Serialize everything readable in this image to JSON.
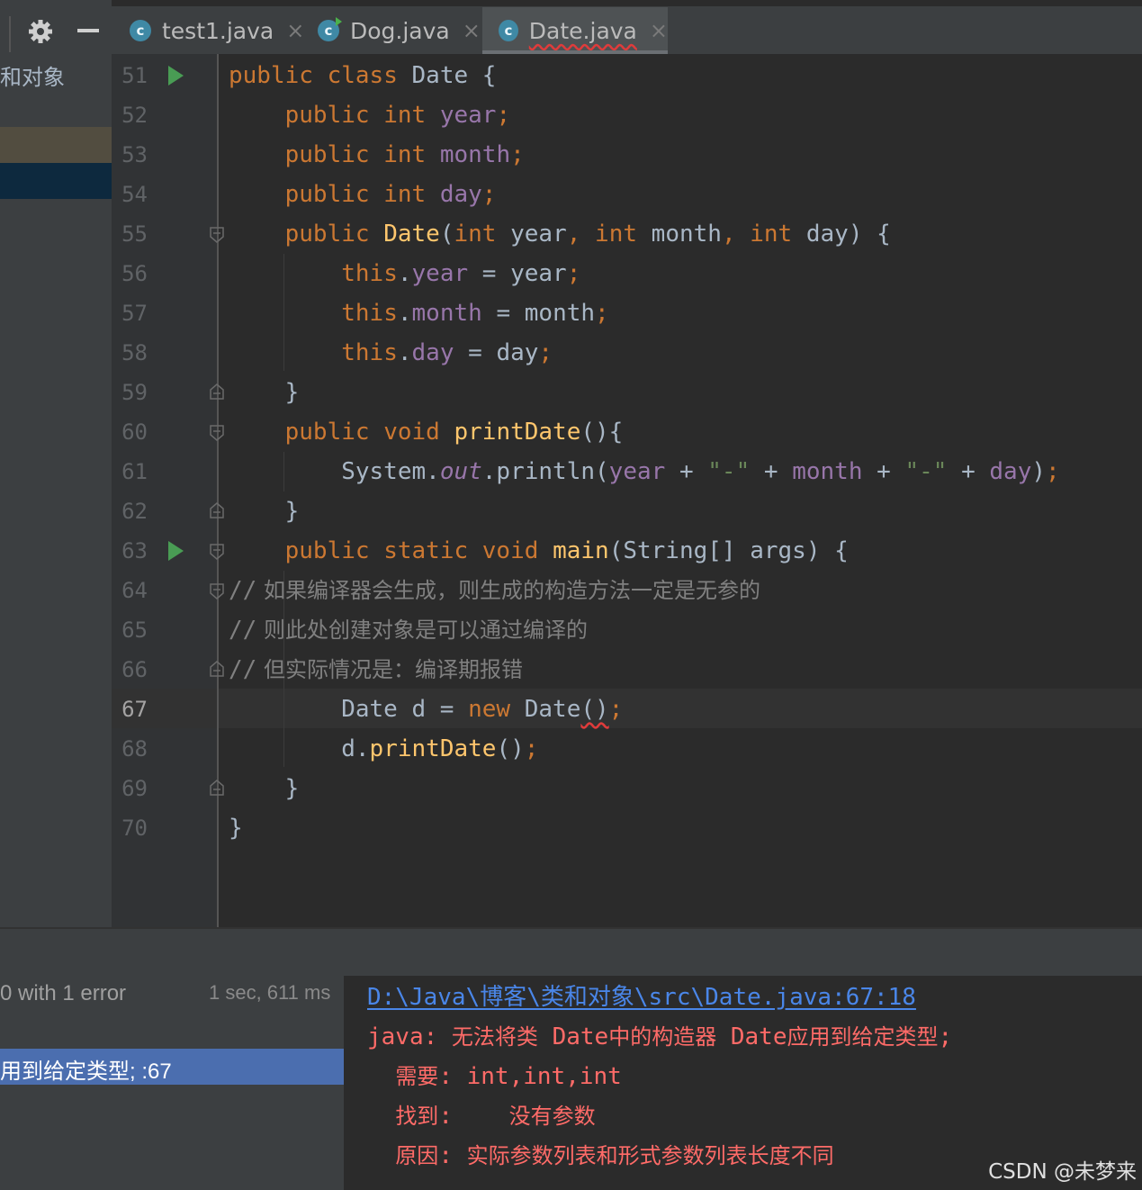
{
  "project_panel": {
    "label": "和对象",
    "settings_icon": "gear-icon",
    "hide_icon": "minus-icon"
  },
  "tabs": [
    {
      "name": "test1.java",
      "icon": "java-class-icon",
      "active": false
    },
    {
      "name": "Dog.java",
      "icon": "java-class-runnable-icon",
      "active": false
    },
    {
      "name": "Date.java",
      "icon": "java-class-icon",
      "active": true
    }
  ],
  "tab_close_glyph": "×",
  "tab_icon_letter": "c",
  "editor": {
    "current_line": "67",
    "lines": [
      {
        "n": "51",
        "text": "public class Date {"
      },
      {
        "n": "52",
        "text": "    public int year;"
      },
      {
        "n": "53",
        "text": "    public int month;"
      },
      {
        "n": "54",
        "text": "    public int day;"
      },
      {
        "n": "55",
        "text": "    public Date(int year, int month, int day) {"
      },
      {
        "n": "56",
        "text": "        this.year = year;"
      },
      {
        "n": "57",
        "text": "        this.month = month;"
      },
      {
        "n": "58",
        "text": "        this.day = day;"
      },
      {
        "n": "59",
        "text": "    }"
      },
      {
        "n": "60",
        "text": "    public void printDate(){"
      },
      {
        "n": "61",
        "text": "        System.out.println(year + \"-\" + month + \"-\" + day);"
      },
      {
        "n": "62",
        "text": "    }"
      },
      {
        "n": "63",
        "text": "    public static void main(String[] args) {"
      },
      {
        "n": "64",
        "text": "// 如果编译器会生成，则生成的构造方法一定是无参的"
      },
      {
        "n": "65",
        "text": "// 则此处创建对象是可以通过编译的"
      },
      {
        "n": "66",
        "text": "// 但实际情况是：编译期报错"
      },
      {
        "n": "67",
        "text": "        Date d = new Date();"
      },
      {
        "n": "68",
        "text": "        d.printDate();"
      },
      {
        "n": "69",
        "text": "    }"
      },
      {
        "n": "70",
        "text": "}"
      }
    ]
  },
  "build": {
    "status": "0 with 1 error",
    "time": "1 sec, 611 ms",
    "selected_item": "用到给定类型; :67",
    "output_link": "D:\\Java\\博客\\类和对象\\src\\Date.java:67:18",
    "error_line1": "java: 无法将类 Date中的构造器 Date应用到给定类型;",
    "required": "  需要: int,int,int",
    "found": "  找到:    没有参数",
    "reason": "  原因: 实际参数列表和形式参数列表长度不同"
  },
  "watermark": "CSDN @未梦来",
  "colors": {
    "keyword": "#cc7832",
    "field": "#9876aa",
    "method": "#ffc66d",
    "string": "#6a8759",
    "comment": "#808080",
    "error": "#ff6b68",
    "link": "#4a86e8",
    "selection": "#4b6eaf"
  }
}
